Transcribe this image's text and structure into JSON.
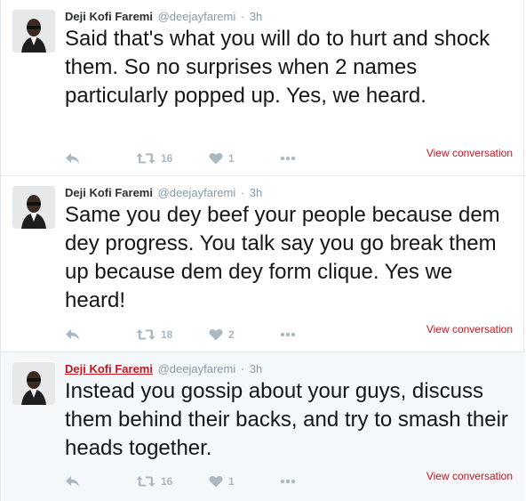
{
  "colors": {
    "link_red": "#c4161c",
    "muted": "#8899a6",
    "action_gray": "#aab8c2",
    "highlight_bg": "#f5f8fa"
  },
  "tweets": [
    {
      "fullname": "Deji Kofi Faremi",
      "username": "@deejayfaremi",
      "separator": "·",
      "time": "3h",
      "text": "Said that's what you will do to hurt and shock them. So no surprises when 2 names particularly popped up. Yes, we heard.",
      "retweets": "16",
      "likes": "1",
      "view_conversation": "View conversation"
    },
    {
      "fullname": "Deji Kofi Faremi",
      "username": "@deejayfaremi",
      "separator": "·",
      "time": "3h",
      "text": "Same you dey beef your people because dem dey progress. You talk say you go break them up because dem dey form clique. Yes we heard!",
      "retweets": "18",
      "likes": "2",
      "view_conversation": "View conversation"
    },
    {
      "fullname": "Deji Kofi Faremi",
      "username": "@deejayfaremi",
      "separator": "·",
      "time": "3h",
      "text": "Instead you gossip about your guys, discuss them behind their backs, and try to smash their heads together.",
      "retweets": "16",
      "likes": "1",
      "view_conversation": "View conversation"
    }
  ],
  "icons": {
    "reply": "reply-icon",
    "retweet": "retweet-icon",
    "like": "heart-icon",
    "more": "more-dots-icon"
  }
}
